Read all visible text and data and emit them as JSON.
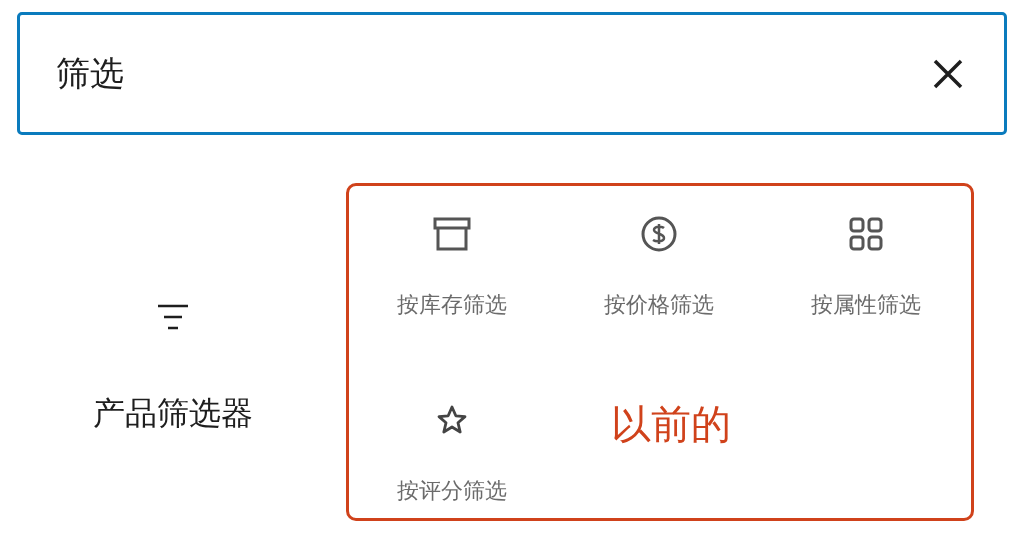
{
  "search": {
    "value": "筛选"
  },
  "results": [
    {
      "kind": "filter",
      "label": "产品筛选器"
    }
  ],
  "previous_group": {
    "annotation": "以前的",
    "items": [
      {
        "kind": "box",
        "label": "按库存筛选"
      },
      {
        "kind": "dollar",
        "label": "按价格筛选"
      },
      {
        "kind": "grid",
        "label": "按属性筛选"
      },
      {
        "kind": "star",
        "label": "按评分筛选"
      }
    ]
  }
}
